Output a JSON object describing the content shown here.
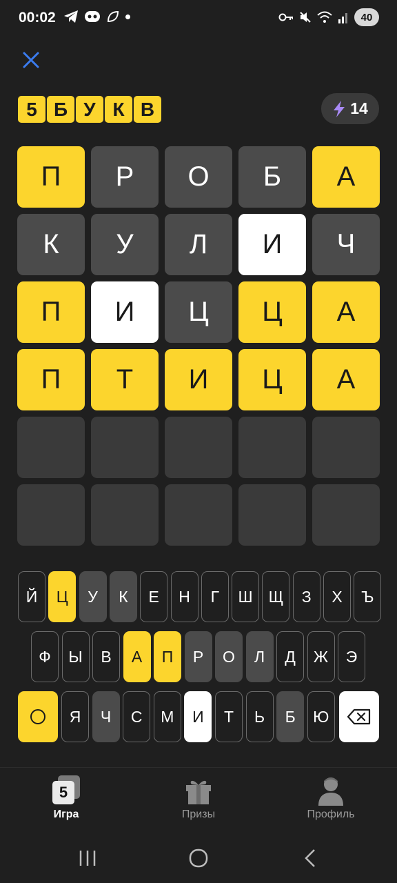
{
  "status_bar": {
    "time": "00:02",
    "battery": "40"
  },
  "header": {
    "logo_letters": [
      "5",
      "Б",
      "У",
      "К",
      "В"
    ],
    "energy_count": "14"
  },
  "grid": {
    "rows": [
      [
        {
          "letter": "П",
          "state": "yellow"
        },
        {
          "letter": "Р",
          "state": "gray"
        },
        {
          "letter": "О",
          "state": "gray"
        },
        {
          "letter": "Б",
          "state": "gray"
        },
        {
          "letter": "А",
          "state": "yellow"
        }
      ],
      [
        {
          "letter": "К",
          "state": "gray"
        },
        {
          "letter": "У",
          "state": "gray"
        },
        {
          "letter": "Л",
          "state": "gray"
        },
        {
          "letter": "И",
          "state": "white"
        },
        {
          "letter": "Ч",
          "state": "gray"
        }
      ],
      [
        {
          "letter": "П",
          "state": "yellow"
        },
        {
          "letter": "И",
          "state": "white"
        },
        {
          "letter": "Ц",
          "state": "gray"
        },
        {
          "letter": "Ц",
          "state": "yellow"
        },
        {
          "letter": "А",
          "state": "yellow"
        }
      ],
      [
        {
          "letter": "П",
          "state": "yellow"
        },
        {
          "letter": "Т",
          "state": "yellow"
        },
        {
          "letter": "И",
          "state": "yellow"
        },
        {
          "letter": "Ц",
          "state": "yellow"
        },
        {
          "letter": "А",
          "state": "yellow"
        }
      ],
      [
        {
          "letter": "",
          "state": "empty"
        },
        {
          "letter": "",
          "state": "empty"
        },
        {
          "letter": "",
          "state": "empty"
        },
        {
          "letter": "",
          "state": "empty"
        },
        {
          "letter": "",
          "state": "empty"
        }
      ],
      [
        {
          "letter": "",
          "state": "empty"
        },
        {
          "letter": "",
          "state": "empty"
        },
        {
          "letter": "",
          "state": "empty"
        },
        {
          "letter": "",
          "state": "empty"
        },
        {
          "letter": "",
          "state": "empty"
        }
      ]
    ]
  },
  "keyboard": {
    "row1": [
      {
        "key": "Й",
        "state": "none"
      },
      {
        "key": "Ц",
        "state": "yellow"
      },
      {
        "key": "У",
        "state": "gray"
      },
      {
        "key": "К",
        "state": "gray"
      },
      {
        "key": "Е",
        "state": "none"
      },
      {
        "key": "Н",
        "state": "none"
      },
      {
        "key": "Г",
        "state": "none"
      },
      {
        "key": "Ш",
        "state": "none"
      },
      {
        "key": "Щ",
        "state": "none"
      },
      {
        "key": "З",
        "state": "none"
      },
      {
        "key": "Х",
        "state": "none"
      },
      {
        "key": "Ъ",
        "state": "none"
      }
    ],
    "row2": [
      {
        "key": "Ф",
        "state": "none"
      },
      {
        "key": "Ы",
        "state": "none"
      },
      {
        "key": "В",
        "state": "none"
      },
      {
        "key": "А",
        "state": "yellow"
      },
      {
        "key": "П",
        "state": "yellow"
      },
      {
        "key": "Р",
        "state": "gray"
      },
      {
        "key": "О",
        "state": "gray"
      },
      {
        "key": "Л",
        "state": "gray"
      },
      {
        "key": "Д",
        "state": "none"
      },
      {
        "key": "Ж",
        "state": "none"
      },
      {
        "key": "Э",
        "state": "none"
      }
    ],
    "row3": [
      {
        "key": "Я",
        "state": "none"
      },
      {
        "key": "Ч",
        "state": "gray"
      },
      {
        "key": "С",
        "state": "none"
      },
      {
        "key": "М",
        "state": "none"
      },
      {
        "key": "И",
        "state": "white"
      },
      {
        "key": "Т",
        "state": "none"
      },
      {
        "key": "Ь",
        "state": "none"
      },
      {
        "key": "Б",
        "state": "gray"
      },
      {
        "key": "Ю",
        "state": "none"
      }
    ]
  },
  "bottom_nav": {
    "game_label": "Игра",
    "game_badge": "5",
    "prizes_label": "Призы",
    "profile_label": "Профиль"
  },
  "colors": {
    "yellow": "#fcd52d",
    "gray": "#4b4b4b",
    "white": "#ffffff",
    "empty": "#3a3a3a",
    "background": "#1f1f1f"
  }
}
